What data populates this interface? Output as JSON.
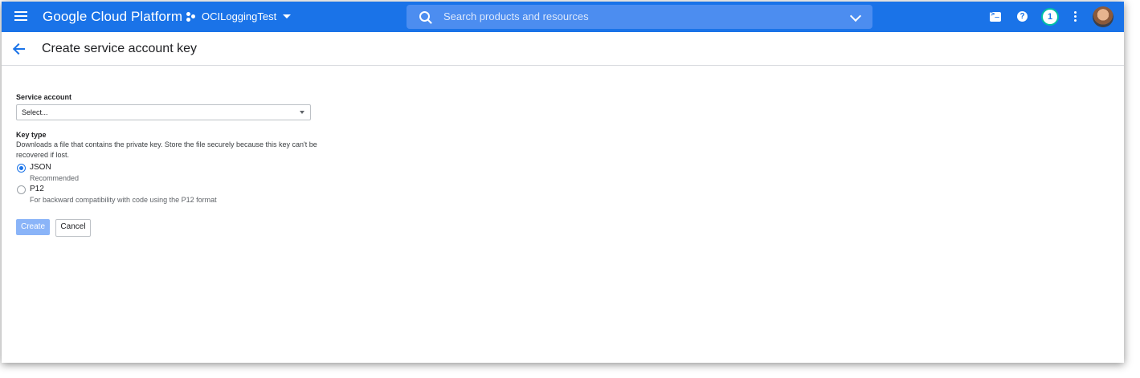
{
  "app": {
    "brand": "Google Cloud Platform",
    "project_name": "OCILoggingTest"
  },
  "search": {
    "placeholder": "Search products and resources"
  },
  "toolbar": {
    "notification_count": "1",
    "help_label": "?",
    "icons": [
      "cloud-shell-icon",
      "help-icon",
      "notification-icon",
      "more-vert-icon",
      "avatar"
    ]
  },
  "page": {
    "title": "Create service account key"
  },
  "form": {
    "service_account_label": "Service account",
    "service_account_value": "Select...",
    "key_type_label": "Key type",
    "key_type_description": "Downloads a file that contains the private key. Store the file securely because this key can't be recovered if lost.",
    "options": [
      {
        "label": "JSON",
        "sublabel": "Recommended",
        "selected": true
      },
      {
        "label": "P12",
        "sublabel": "For backward compatibility with code using the P12 format",
        "selected": false
      }
    ],
    "create_label": "Create",
    "cancel_label": "Cancel"
  },
  "colors": {
    "topbar": "#1a73e8",
    "accent": "#1a73e8",
    "create_disabled": "#8ab4f8"
  }
}
